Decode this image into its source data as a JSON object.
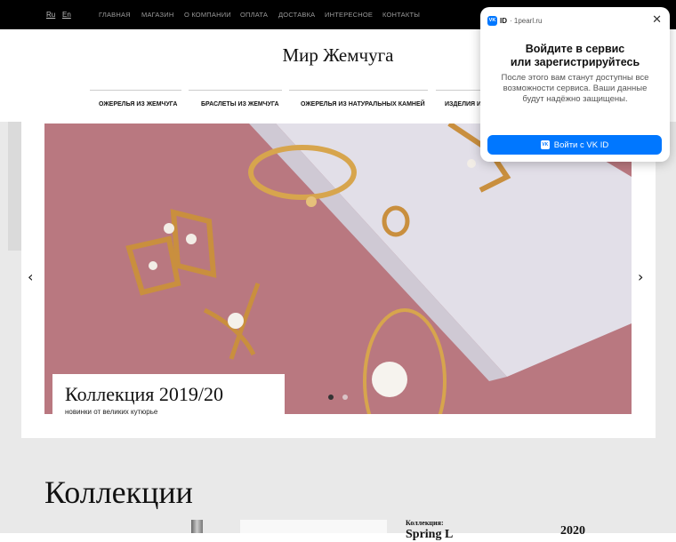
{
  "topbar": {
    "languages": [
      "Ru",
      "En"
    ],
    "nav": [
      "ГЛАВНАЯ",
      "МАГАЗИН",
      "О КОМПАНИИ",
      "ОПЛАТА",
      "ДОСТАВКА",
      "ИНТЕРЕСНОЕ",
      "КОНТАКТЫ"
    ]
  },
  "logo": "Мир Жемчуга",
  "categories": [
    "ОЖЕРЕЛЬЯ ИЗ ЖЕМЧУГА",
    "БРАСЛЕТЫ ИЗ ЖЕМЧУГА",
    "ОЖЕРЕЛЬЯ ИЗ НАТУРАЛЬНЫХ КАМНЕЙ",
    "ИЗДЕЛИЯ И"
  ],
  "slider": {
    "prev_icon": "chevron-left-icon",
    "next_icon": "chevron-right-icon",
    "caption_title": "Коллекция 2019/20",
    "caption_subtitle": "новинки от великих кутюрье",
    "dots": 2,
    "active_dot": 0
  },
  "collections": {
    "title": "Коллекции",
    "label": "Коллекция:",
    "name": "Spring L",
    "year": "2020"
  },
  "vk_popup": {
    "badge": "ID",
    "domain": "· 1pearl.ru",
    "title": "Войдите в сервис\nили зарегистрируйтесь",
    "text": "После этого вам станут доступны все возможности сервиса. Ваши данные будут надёжно защищены.",
    "button": "Войти с VK ID",
    "close_icon": "close-icon"
  },
  "colors": {
    "accent": "#0077ff",
    "topbar": "#000000",
    "slide_bg": "#b97880"
  }
}
